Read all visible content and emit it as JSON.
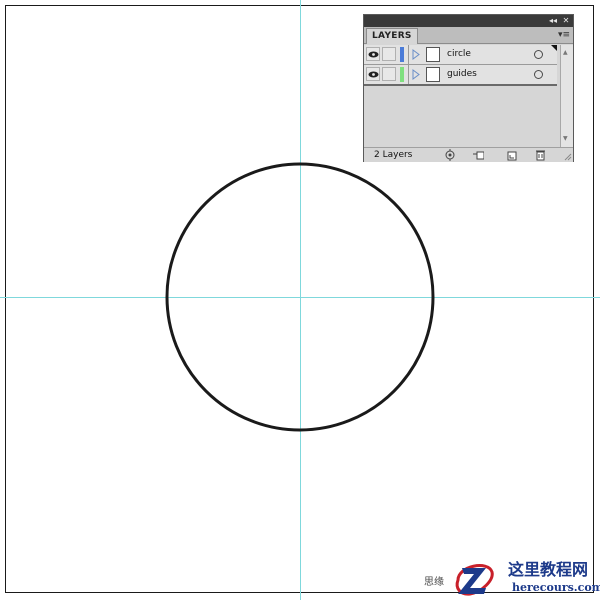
{
  "canvas": {
    "guide_color": "#7fd8dc",
    "shape": "circle",
    "stroke_color": "#1a1a1a"
  },
  "layers_panel": {
    "tab_label": "LAYERS",
    "collapse_glyph": "◂◂",
    "close_glyph": "✕",
    "menu_glyph": "▾≡",
    "layers": [
      {
        "name": "circle",
        "color": "#4a7bd8",
        "visible": true,
        "selected": true
      },
      {
        "name": "guides",
        "color": "#7fe07f",
        "visible": true,
        "selected": false
      }
    ],
    "layer_count": "2 Layers",
    "footer_icons": [
      "locate-object-icon",
      "make-clipping-mask-icon",
      "new-sublayer-icon",
      "trash-icon"
    ]
  },
  "watermark": {
    "small_text": "思缘",
    "chinese_name": "这里教程网",
    "domain": "herecours.com"
  }
}
